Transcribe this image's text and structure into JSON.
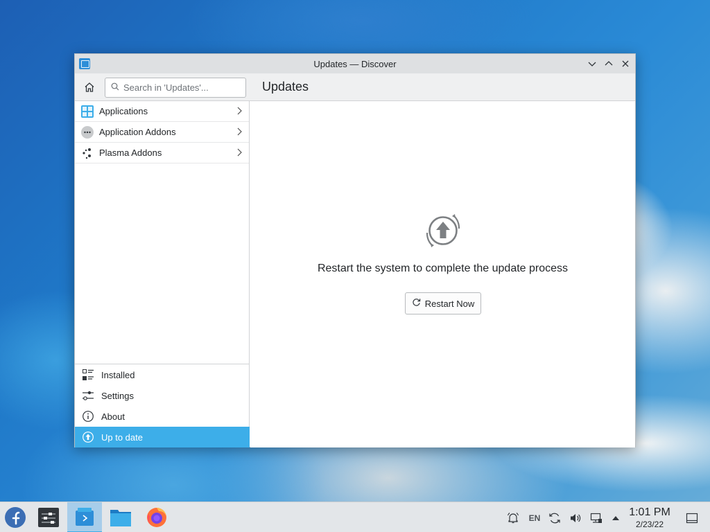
{
  "window": {
    "title": "Updates — Discover"
  },
  "toolbar": {
    "search_placeholder": "Search in 'Updates'...",
    "page_title": "Updates"
  },
  "sidebar": {
    "categories": [
      {
        "label": "Applications",
        "icon": "applications-grid-icon"
      },
      {
        "label": "Application Addons",
        "icon": "addons-dots-icon"
      },
      {
        "label": "Plasma Addons",
        "icon": "plasma-addons-icon"
      }
    ],
    "nav": [
      {
        "label": "Installed",
        "icon": "installed-list-icon"
      },
      {
        "label": "Settings",
        "icon": "settings-sliders-icon"
      },
      {
        "label": "About",
        "icon": "info-icon"
      },
      {
        "label": "Up to date",
        "icon": "update-arrow-icon",
        "active": true
      }
    ]
  },
  "main": {
    "message": "Restart the system to complete the update process",
    "restart_button": "Restart Now"
  },
  "taskbar": {
    "apps": [
      "fedora-launcher-icon",
      "system-settings-icon",
      "discover-icon",
      "file-manager-icon",
      "firefox-icon"
    ],
    "active_app": "discover-icon",
    "tray": {
      "keyboard_layout": "EN",
      "time": "1:01 PM",
      "date": "2/23/22"
    }
  },
  "colors": {
    "accent": "#3daee9",
    "titlebar": "#dee0e2",
    "toolbar": "#eff0f1"
  }
}
